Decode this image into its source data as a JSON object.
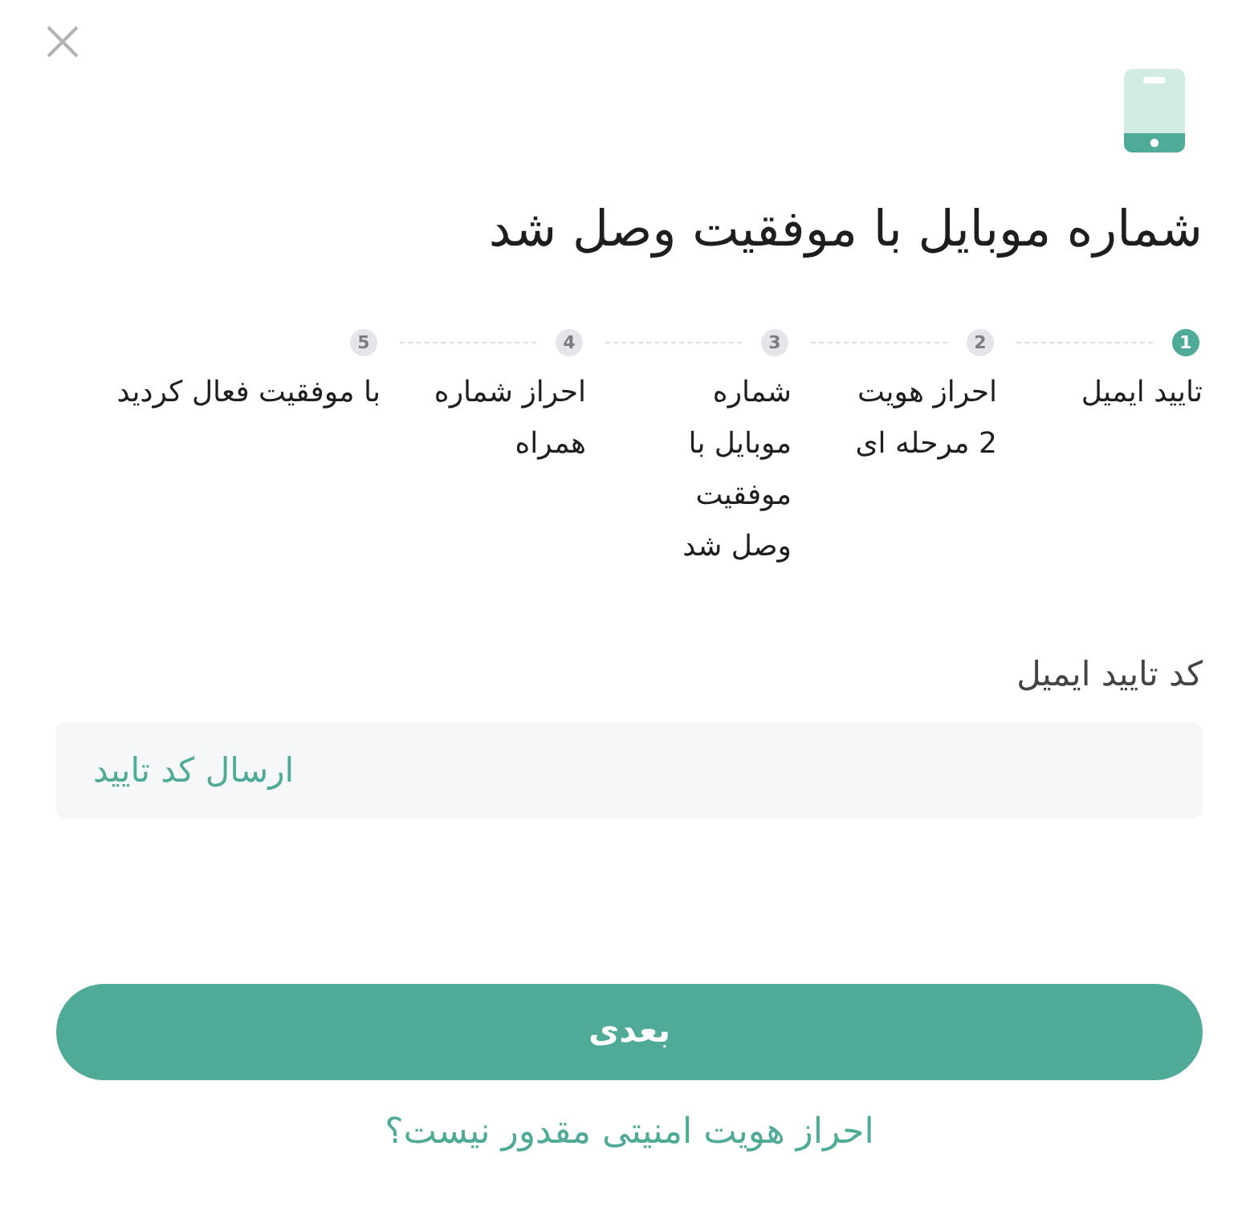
{
  "title": "شماره موبایل با موفقیت وصل شد",
  "steps": [
    {
      "number": "1",
      "label": "تایید ایمیل",
      "active": true
    },
    {
      "number": "2",
      "label": "احراز هویت 2 مرحله ای",
      "active": false
    },
    {
      "number": "3",
      "label": "شماره موبایل با موفقیت وصل شد",
      "active": false
    },
    {
      "number": "4",
      "label": "احراز شماره همراه",
      "active": false
    },
    {
      "number": "5",
      "label": "با موفقیت فعال کردید",
      "active": false
    }
  ],
  "code_field": {
    "label": "کد تایید ایمیل",
    "send_button": "ارسال کد تایید"
  },
  "next_button": {
    "label": "بعدی"
  },
  "help_link": {
    "label": "احراز هویت امنیتی مقدور نیست؟"
  }
}
